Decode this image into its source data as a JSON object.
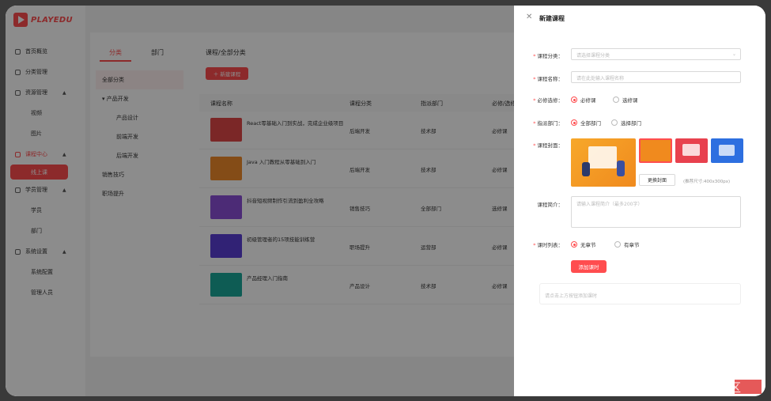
{
  "app": {
    "logo_text": "PLAYEDU"
  },
  "sidebar": {
    "items": [
      {
        "label": "首页概览",
        "icon": "home-icon"
      },
      {
        "label": "分类管理",
        "icon": "category-icon"
      },
      {
        "label": "资源管理",
        "icon": "resource-icon",
        "arrow": "▲"
      },
      {
        "label": "视频",
        "sub": true
      },
      {
        "label": "图片",
        "sub": true
      },
      {
        "label": "课程中心",
        "icon": "course-icon",
        "arrow": "▲",
        "active": true
      },
      {
        "label": "线上课",
        "sub": true,
        "selected": true
      },
      {
        "label": "学员管理",
        "icon": "user-icon",
        "arrow": "▲"
      },
      {
        "label": "学员",
        "sub": true
      },
      {
        "label": "部门",
        "sub": true
      },
      {
        "label": "系统设置",
        "icon": "settings-icon",
        "arrow": "▲"
      },
      {
        "label": "系统配置",
        "sub": true
      },
      {
        "label": "管理人员",
        "sub": true
      }
    ]
  },
  "tree": {
    "tabs": [
      "分类",
      "部门"
    ],
    "items": [
      {
        "label": "全部分类",
        "level": 1,
        "selected": true
      },
      {
        "label": "▾ 产品开发",
        "level": 1
      },
      {
        "label": "产品设计",
        "level": 3
      },
      {
        "label": "前端开发",
        "level": 3
      },
      {
        "label": "后端开发",
        "level": 3
      },
      {
        "label": "销售技巧",
        "level": 1
      },
      {
        "label": "职场提升",
        "level": 1
      }
    ]
  },
  "list": {
    "breadcrumb": "课程/全部分类",
    "new_button": "＋ 新建课程",
    "columns": [
      "课程名称",
      "课程分类",
      "指派部门",
      "必修/选修"
    ],
    "rows": [
      {
        "name": "React零基础入门到实战，完成企业级项目",
        "category": "后端开发",
        "dept": "技术部",
        "type": "必修课",
        "color": "#e04848"
      },
      {
        "name": "Java 入门教程从零基础到入门",
        "category": "后端开发",
        "dept": "技术部",
        "type": "必修课",
        "color": "#f08a2a"
      },
      {
        "name": "抖音短视频制作引流到盈利全攻略",
        "category": "销售技巧",
        "dept": "全部部门",
        "type": "选修课",
        "color": "#8a4fd8"
      },
      {
        "name": "初级管理者的15项技能训练营",
        "category": "职场提升",
        "dept": "运营部",
        "type": "必修课",
        "color": "#5a3fd6"
      },
      {
        "name": "产品经理入门指南",
        "category": "产品设计",
        "dept": "技术部",
        "type": "必修课",
        "color": "#1aa89a"
      }
    ]
  },
  "drawer": {
    "close": "✕",
    "title": "新建课程",
    "category_label": "课程分类：",
    "category_placeholder": "请选择课程分类",
    "name_label": "课程名称：",
    "name_placeholder": "请在此处输入课程名称",
    "required_label": "必修选修：",
    "required_opt1": "必修课",
    "required_opt2": "选修课",
    "dept_label": "指派部门：",
    "dept_opt1": "全部部门",
    "dept_opt2": "选择部门",
    "cover_label": "课程封面：",
    "change_cover": "更换封面",
    "cover_hint": "(推荐尺寸:400x300px)",
    "intro_label": "课程简介：",
    "intro_placeholder": "请输入课程简介（最多200字）",
    "lessons_label": "课时列表：",
    "lessons_opt1": "无章节",
    "lessons_opt2": "有章节",
    "add_lesson": "添加课时",
    "empty_hint": "请点击上方按钮添加课时"
  },
  "watermark": "@稀土掘金技术社区"
}
